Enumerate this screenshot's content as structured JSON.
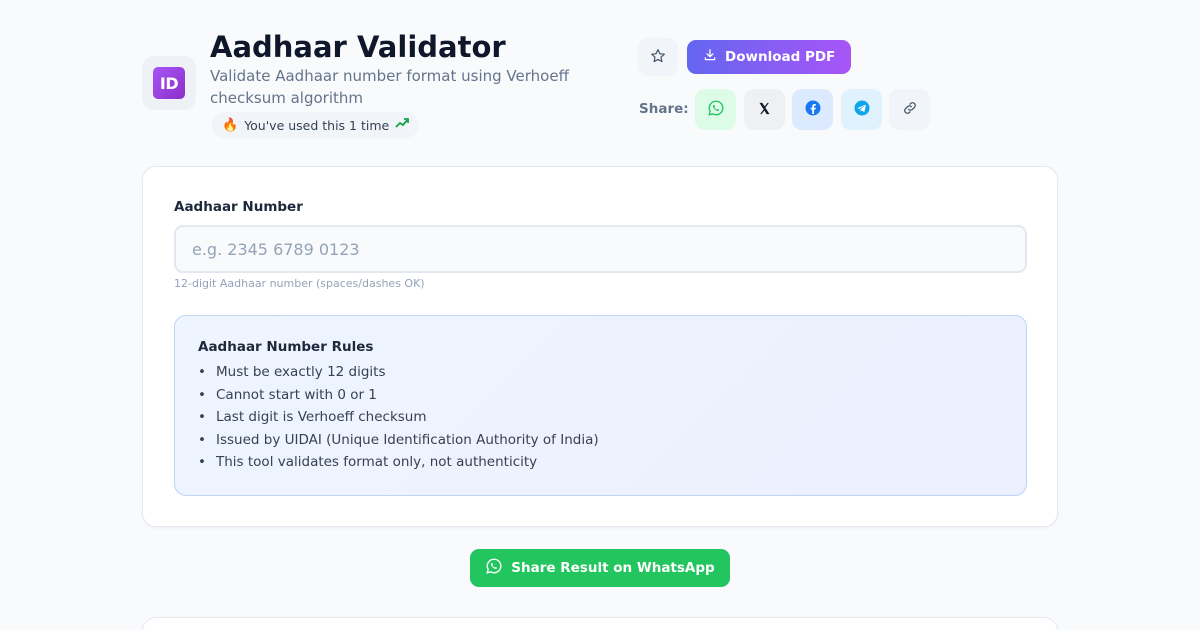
{
  "app": {
    "icon_text": "ID",
    "title": "Aadhaar Validator",
    "subtitle": "Validate Aadhaar number format using Verhoeff checksum algorithm",
    "usage_text": "You've used this 1 time"
  },
  "toolbar": {
    "favorite_icon": "star-icon",
    "download_label": "Download PDF",
    "share_label": "Share:",
    "share_buttons": [
      {
        "name": "whatsapp",
        "icon": "whatsapp-icon",
        "bg": "#dcfce7",
        "color": "#22c55e"
      },
      {
        "name": "x",
        "icon": "x-icon",
        "bg": "#eef0f3",
        "color": "#111827"
      },
      {
        "name": "facebook",
        "icon": "facebook-icon",
        "bg": "#dbeafe",
        "color": "#1877f2"
      },
      {
        "name": "telegram",
        "icon": "telegram-icon",
        "bg": "#e0f2fe",
        "color": "#0ea5e9"
      },
      {
        "name": "copy-link",
        "icon": "link-icon",
        "bg": "#f1f5f9",
        "color": "#475569"
      }
    ]
  },
  "form": {
    "label": "Aadhaar Number",
    "value": "",
    "placeholder": "e.g. 2345 6789 0123",
    "hint": "12-digit Aadhaar number (spaces/dashes OK)"
  },
  "rules": {
    "title": "Aadhaar Number Rules",
    "items": [
      "Must be exactly 12 digits",
      "Cannot start with 0 or 1",
      "Last digit is Verhoeff checksum",
      "Issued by UIDAI (Unique Identification Authority of India)",
      "This tool validates format only, not authenticity"
    ]
  },
  "actions": {
    "whatsapp_share_label": "Share Result on WhatsApp"
  },
  "colors": {
    "accent_start": "#6366f1",
    "accent_end": "#a855f7",
    "whatsapp_green": "#22c55e"
  }
}
